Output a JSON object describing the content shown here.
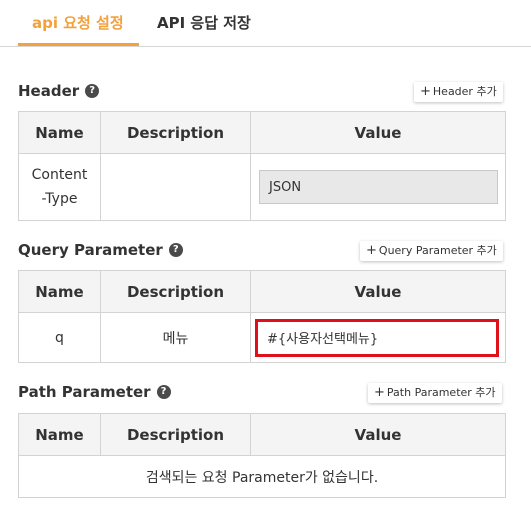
{
  "tabs": [
    {
      "label": "api 요청 설정",
      "active": true
    },
    {
      "label": "API 응답 저장",
      "active": false
    }
  ],
  "accent_color": "#f2a13c",
  "highlight_color": "#e0101a",
  "columns": {
    "name": "Name",
    "description": "Description",
    "value": "Value"
  },
  "header_section": {
    "title": "Header",
    "help_icon": "question-circle-icon",
    "add_label": "Header 추가",
    "rows": [
      {
        "name": "Content\n-Type",
        "description": "",
        "value": "JSON"
      }
    ]
  },
  "query_section": {
    "title": "Query Parameter",
    "help_icon": "question-circle-icon",
    "add_label": "Query Parameter 추가",
    "rows": [
      {
        "name": "q",
        "description": "메뉴",
        "value": "#{사용자선택메뉴}"
      }
    ]
  },
  "path_section": {
    "title": "Path Parameter",
    "help_icon": "question-circle-icon",
    "add_label": "Path Parameter 추가",
    "empty_message": "검색되는 요청 Parameter가 없습니다."
  }
}
